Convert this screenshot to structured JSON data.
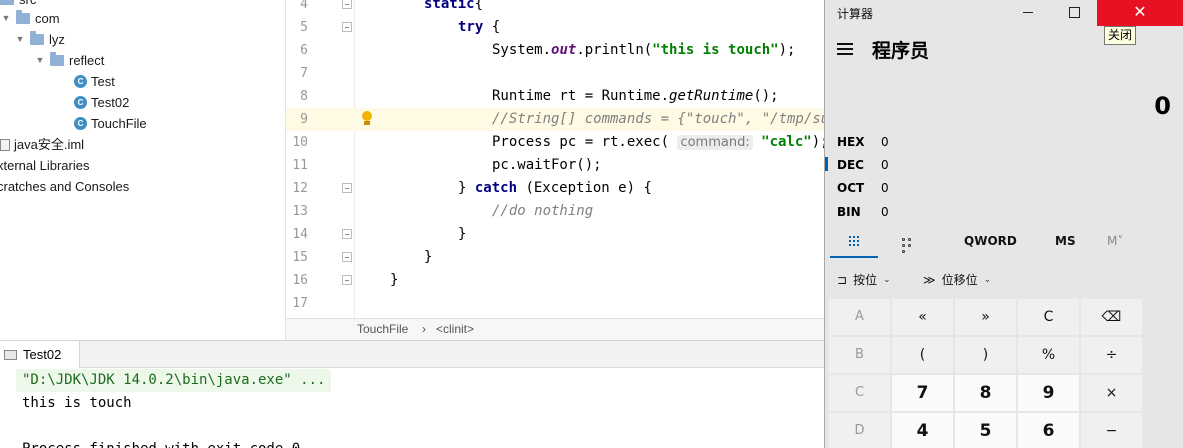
{
  "project_tree": {
    "items": [
      {
        "label": "src",
        "kind": "folder"
      },
      {
        "label": "com",
        "kind": "folder"
      },
      {
        "label": "lyz",
        "kind": "folder"
      },
      {
        "label": "reflect",
        "kind": "folder"
      },
      {
        "label": "Test",
        "kind": "class"
      },
      {
        "label": "Test02",
        "kind": "class"
      },
      {
        "label": "TouchFile",
        "kind": "class"
      },
      {
        "label": "java安全.iml",
        "kind": "module"
      },
      {
        "label": "xternal Libraries",
        "kind": "libraries"
      },
      {
        "label": "cratches and Consoles",
        "kind": "scratches"
      }
    ]
  },
  "editor": {
    "lines": [
      {
        "num": "4",
        "tokens": [
          [
            "kw",
            "static"
          ],
          [
            "",
            "{"
          ]
        ]
      },
      {
        "num": "5",
        "tokens": [
          [
            "kw",
            "try"
          ],
          [
            "",
            " {"
          ]
        ]
      },
      {
        "num": "6",
        "tokens": [
          [
            "",
            "System."
          ],
          [
            "fld",
            "out"
          ],
          [
            "",
            ".println("
          ],
          [
            "str",
            "\"this is touch\""
          ],
          [
            "",
            ");"
          ]
        ]
      },
      {
        "num": "7",
        "tokens": []
      },
      {
        "num": "8",
        "tokens": [
          [
            "",
            "Runtime rt = Runtime."
          ],
          [
            "it",
            "getRuntime"
          ],
          [
            "",
            "();"
          ]
        ]
      },
      {
        "num": "9",
        "tokens": [
          [
            "cmt",
            "//String[] commands = {\"touch\", \"/tmp/su"
          ]
        ],
        "highlight": true
      },
      {
        "num": "10",
        "tokens": [
          [
            "",
            "Process pc = rt.exec( "
          ],
          [
            "hint",
            "command:"
          ],
          [
            "",
            " "
          ],
          [
            "str",
            "\"calc\""
          ],
          [
            "",
            ");"
          ]
        ]
      },
      {
        "num": "11",
        "tokens": [
          [
            "",
            "pc.waitFor();"
          ]
        ]
      },
      {
        "num": "12",
        "tokens": [
          [
            "",
            "} "
          ],
          [
            "kw",
            "catch"
          ],
          [
            "",
            " (Exception e) {"
          ]
        ]
      },
      {
        "num": "13",
        "tokens": [
          [
            "cmt",
            "//do nothing"
          ]
        ]
      },
      {
        "num": "14",
        "tokens": [
          [
            "",
            "}"
          ]
        ]
      },
      {
        "num": "15",
        "tokens": [
          [
            "",
            "}"
          ]
        ]
      },
      {
        "num": "16",
        "tokens": [
          [
            "",
            "}"
          ]
        ]
      },
      {
        "num": "17",
        "tokens": []
      }
    ],
    "breadcrumb": {
      "file": "TouchFile",
      "separator": "›",
      "member": "<clinit>"
    }
  },
  "run_panel": {
    "tab_label": "Test02",
    "console_lines": [
      {
        "text": "\"D:\\JDK\\JDK 14.0.2\\bin\\java.exe\" ...",
        "kind": "cmd"
      },
      {
        "text": "this is touch",
        "kind": "out"
      },
      {
        "text": "",
        "kind": "out"
      },
      {
        "text": "Process finished with exit code 0",
        "kind": "out"
      }
    ]
  },
  "calculator": {
    "window_title": "计算器",
    "close_tooltip": "关闭",
    "mode_title": "程序员",
    "display_value": "0",
    "radix": [
      {
        "name": "HEX",
        "value": "0"
      },
      {
        "name": "DEC",
        "value": "0",
        "selected": true
      },
      {
        "name": "OCT",
        "value": "0"
      },
      {
        "name": "BIN",
        "value": "0"
      }
    ],
    "word_size": "QWORD",
    "ms_label": "MS",
    "mem_label": "M˅",
    "bitwise_label": "按位",
    "bitshift_label": "位移位",
    "keys": [
      [
        "A",
        "«",
        "»",
        "C",
        "⌫"
      ],
      [
        "B",
        "(",
        ")",
        "%",
        "÷"
      ],
      [
        "C",
        "7",
        "8",
        "9",
        "×"
      ],
      [
        "D",
        "4",
        "5",
        "6",
        "−"
      ]
    ],
    "accent_color": "#0063b1",
    "close_color": "#e81123"
  }
}
